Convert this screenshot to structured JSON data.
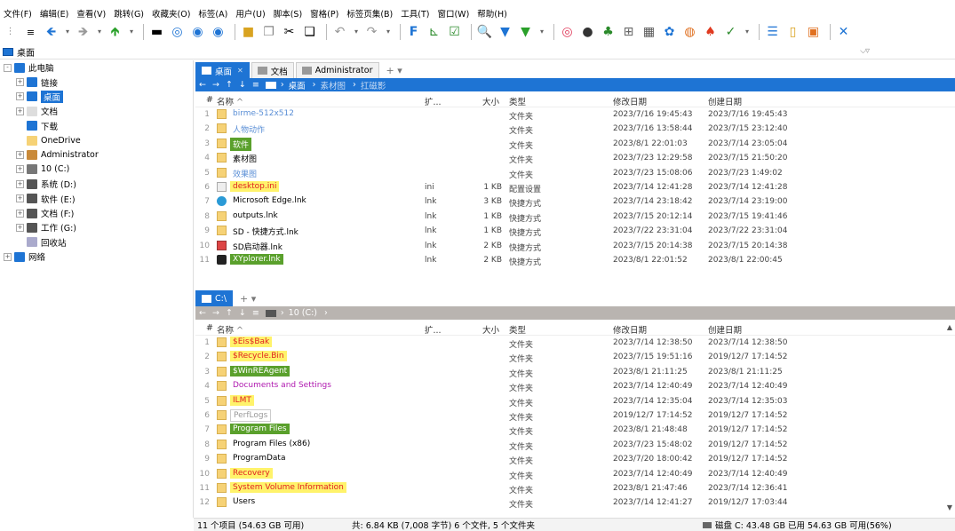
{
  "menu": [
    "文件(F)",
    "编辑(E)",
    "查看(V)",
    "跳转(G)",
    "收藏夹(O)",
    "标签(A)",
    "用户(U)",
    "脚本(S)",
    "窗格(P)",
    "标签页集(B)",
    "工具(T)",
    "窗口(W)",
    "帮助(H)"
  ],
  "address": {
    "path": "桌面"
  },
  "tree": [
    {
      "label": "此电脑",
      "indent": 0,
      "exp": "-",
      "icon": "monitor-icon",
      "color": "#1e74d4"
    },
    {
      "label": "链接",
      "indent": 1,
      "exp": "+",
      "icon": "link-icon",
      "color": "#1e74d4"
    },
    {
      "label": "桌面",
      "indent": 1,
      "exp": "+",
      "icon": "desktop-icon",
      "color": "#1e74d4",
      "selected": true
    },
    {
      "label": "文档",
      "indent": 1,
      "exp": "+",
      "icon": "document-icon",
      "color": "#ddd"
    },
    {
      "label": "下载",
      "indent": 1,
      "exp": "",
      "icon": "download-icon",
      "color": "#1e74d4"
    },
    {
      "label": "OneDrive",
      "indent": 1,
      "exp": "",
      "icon": "folder-icon",
      "color": "#f6d276"
    },
    {
      "label": "Administrator",
      "indent": 1,
      "exp": "+",
      "icon": "user-icon",
      "color": "#c98a3a"
    },
    {
      "label": "10 (C:)",
      "indent": 1,
      "exp": "+",
      "icon": "drive-icon",
      "color": "#777"
    },
    {
      "label": "系统 (D:)",
      "indent": 1,
      "exp": "+",
      "icon": "drive-icon",
      "color": "#555"
    },
    {
      "label": "软件 (E:)",
      "indent": 1,
      "exp": "+",
      "icon": "drive-icon",
      "color": "#555"
    },
    {
      "label": "文档 (F:)",
      "indent": 1,
      "exp": "+",
      "icon": "drive-icon",
      "color": "#555"
    },
    {
      "label": "工作 (G:)",
      "indent": 1,
      "exp": "+",
      "icon": "drive-icon",
      "color": "#555"
    },
    {
      "label": "回收站",
      "indent": 1,
      "exp": "",
      "icon": "recycle-bin-icon",
      "color": "#aac"
    },
    {
      "label": "网络",
      "indent": 0,
      "exp": "+",
      "icon": "network-icon",
      "color": "#1e74d4"
    }
  ],
  "pane1": {
    "tabs": [
      {
        "label": "桌面",
        "active": true
      },
      {
        "label": "文档"
      },
      {
        "label": "Administrator"
      }
    ],
    "crumbs": [
      "桌面",
      "素材图",
      "扛磁影"
    ],
    "columns": {
      "num": "#",
      "name": "名称",
      "ext": "扩...",
      "size": "大小",
      "type": "类型",
      "modified": "修改日期",
      "created": "创建日期"
    },
    "files": [
      {
        "n": "1",
        "name": "birme-512x512",
        "ext": "",
        "size": "",
        "type": "文件夹",
        "mod": "2023/7/16 19:45:43",
        "cre": "2023/7/16 19:45:43",
        "fg": "#5b8fd6",
        "bg": "",
        "icon": "folder"
      },
      {
        "n": "2",
        "name": "人物动作",
        "ext": "",
        "size": "",
        "type": "文件夹",
        "mod": "2023/7/16 13:58:44",
        "cre": "2023/7/15 23:12:40",
        "fg": "#5b8fd6",
        "bg": "",
        "icon": "folder"
      },
      {
        "n": "3",
        "name": "软件",
        "ext": "",
        "size": "",
        "type": "文件夹",
        "mod": "2023/8/1 22:01:03",
        "cre": "2023/7/14 23:05:04",
        "fg": "#ffffff",
        "bg": "#5aa02c",
        "icon": "folder"
      },
      {
        "n": "4",
        "name": "素材图",
        "ext": "",
        "size": "",
        "type": "文件夹",
        "mod": "2023/7/23 12:29:58",
        "cre": "2023/7/15 21:50:20",
        "fg": "#000000",
        "bg": "",
        "icon": "folder"
      },
      {
        "n": "5",
        "name": "效果图",
        "ext": "",
        "size": "",
        "type": "文件夹",
        "mod": "2023/7/23 15:08:06",
        "cre": "2023/7/23 1:49:02",
        "fg": "#5b8fd6",
        "bg": "",
        "icon": "folder"
      },
      {
        "n": "6",
        "name": "desktop.ini",
        "ext": "ini",
        "size": "1 KB",
        "type": "配置设置",
        "mod": "2023/7/14 12:41:28",
        "cre": "2023/7/14 12:41:28",
        "fg": "#e02020",
        "bg": "#fff36b",
        "icon": "file"
      },
      {
        "n": "7",
        "name": "Microsoft Edge.lnk",
        "ext": "lnk",
        "size": "3 KB",
        "type": "快捷方式",
        "mod": "2023/7/14 23:18:42",
        "cre": "2023/7/14 23:19:00",
        "fg": "#000000",
        "bg": "",
        "icon": "edge"
      },
      {
        "n": "8",
        "name": "outputs.lnk",
        "ext": "lnk",
        "size": "1 KB",
        "type": "快捷方式",
        "mod": "2023/7/15 20:12:14",
        "cre": "2023/7/15 19:41:46",
        "fg": "#000000",
        "bg": "",
        "icon": "shortcut"
      },
      {
        "n": "9",
        "name": "SD - 快捷方式.lnk",
        "ext": "lnk",
        "size": "1 KB",
        "type": "快捷方式",
        "mod": "2023/7/22 23:31:04",
        "cre": "2023/7/22 23:31:04",
        "fg": "#000000",
        "bg": "",
        "icon": "shortcut"
      },
      {
        "n": "10",
        "name": "SD启动器.lnk",
        "ext": "lnk",
        "size": "2 KB",
        "type": "快捷方式",
        "mod": "2023/7/15 20:14:38",
        "cre": "2023/7/15 20:14:38",
        "fg": "#000000",
        "bg": "",
        "icon": "sd"
      },
      {
        "n": "11",
        "name": "XYplorer.lnk",
        "ext": "lnk",
        "size": "2 KB",
        "type": "快捷方式",
        "mod": "2023/8/1 22:01:52",
        "cre": "2023/8/1 22:00:45",
        "fg": "#ffffff",
        "bg": "#5aa02c",
        "icon": "xy"
      }
    ]
  },
  "pane2": {
    "tabs": [
      {
        "label": "C:\\",
        "active": true
      }
    ],
    "crumbs": [
      "10 (C:)"
    ],
    "columns": {
      "num": "#",
      "name": "名称",
      "ext": "扩...",
      "size": "大小",
      "type": "类型",
      "modified": "修改日期",
      "created": "创建日期"
    },
    "files": [
      {
        "n": "1",
        "name": "$Eis$Bak",
        "type": "文件夹",
        "mod": "2023/7/14 12:38:50",
        "cre": "2023/7/14 12:38:50",
        "fg": "#e02020",
        "bg": "#fff36b",
        "icon": "folder"
      },
      {
        "n": "2",
        "name": "$Recycle.Bin",
        "type": "文件夹",
        "mod": "2023/7/15 19:51:16",
        "cre": "2019/12/7 17:14:52",
        "fg": "#e02020",
        "bg": "#fff36b",
        "icon": "folder"
      },
      {
        "n": "3",
        "name": "$WinREAgent",
        "type": "文件夹",
        "mod": "2023/8/1 21:11:25",
        "cre": "2023/8/1 21:11:25",
        "fg": "#ffffff",
        "bg": "#5aa02c",
        "icon": "folder"
      },
      {
        "n": "4",
        "name": "Documents and Settings",
        "type": "文件夹",
        "mod": "2023/7/14 12:40:49",
        "cre": "2023/7/14 12:40:49",
        "fg": "#b01ab0",
        "bg": "",
        "icon": "shortcut"
      },
      {
        "n": "5",
        "name": "ILMT",
        "type": "文件夹",
        "mod": "2023/7/14 12:35:04",
        "cre": "2023/7/14 12:35:03",
        "fg": "#e02020",
        "bg": "#fff36b",
        "icon": "folder"
      },
      {
        "n": "6",
        "name": "PerfLogs",
        "type": "文件夹",
        "mod": "2019/12/7 17:14:52",
        "cre": "2019/12/7 17:14:52",
        "fg": "#999999",
        "bg": "",
        "icon": "folder",
        "box": true
      },
      {
        "n": "7",
        "name": "Program Files",
        "type": "文件夹",
        "mod": "2023/8/1 21:48:48",
        "cre": "2019/12/7 17:14:52",
        "fg": "#ffffff",
        "bg": "#5aa02c",
        "icon": "folder"
      },
      {
        "n": "8",
        "name": "Program Files (x86)",
        "type": "文件夹",
        "mod": "2023/7/23 15:48:02",
        "cre": "2019/12/7 17:14:52",
        "fg": "#000000",
        "bg": "",
        "icon": "folder"
      },
      {
        "n": "9",
        "name": "ProgramData",
        "type": "文件夹",
        "mod": "2023/7/20 18:00:42",
        "cre": "2019/12/7 17:14:52",
        "fg": "#000000",
        "bg": "",
        "icon": "folder"
      },
      {
        "n": "10",
        "name": "Recovery",
        "type": "文件夹",
        "mod": "2023/7/14 12:40:49",
        "cre": "2023/7/14 12:40:49",
        "fg": "#e02020",
        "bg": "#fff36b",
        "icon": "folder"
      },
      {
        "n": "11",
        "name": "System Volume Information",
        "type": "文件夹",
        "mod": "2023/8/1 21:47:46",
        "cre": "2023/7/14 12:36:41",
        "fg": "#e02020",
        "bg": "#fff36b",
        "icon": "folder"
      },
      {
        "n": "12",
        "name": "Users",
        "type": "文件夹",
        "mod": "2023/7/14 12:41:27",
        "cre": "2019/12/7 17:03:44",
        "fg": "#000000",
        "bg": "",
        "icon": "folder"
      }
    ]
  },
  "status": {
    "items": "11 个项目 (54.63 GB 可用)",
    "summary": "共: 6.84 KB (7,008 字节)  6 个文件, 5 个文件夹",
    "disk": "磁盘 C: 43.48 GB 已用  54.63 GB 可用(56%)"
  },
  "colors": {
    "accent": "#1e74d4",
    "gray_crumb": "#b9b4b0",
    "green": "#5aa02c",
    "yellow": "#fff36b"
  }
}
